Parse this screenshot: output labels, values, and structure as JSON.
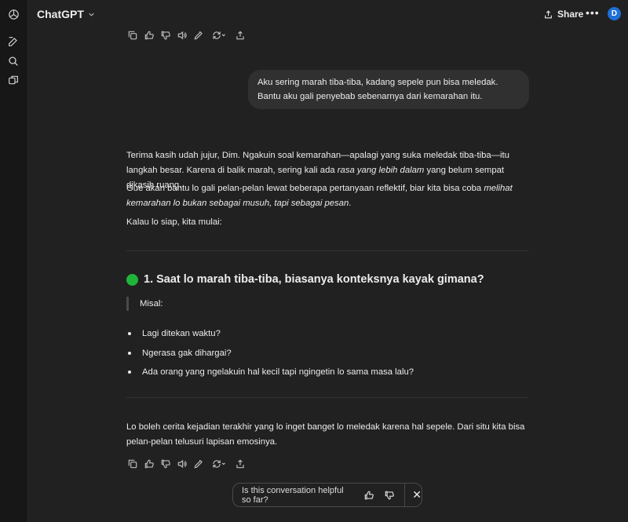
{
  "header": {
    "model_name": "ChatGPT",
    "share_label": "Share",
    "avatar_initial": "D"
  },
  "user_message": "Aku sering marah tiba-tiba, kadang sepele pun bisa meledak. Bantu aku gali penyebab sebenarnya dari kemarahan itu.",
  "assistant": {
    "p1_a": "Terima kasih udah jujur, Dim. Ngakuin soal kemarahan—apalagi yang suka meledak tiba-tiba—itu langkah besar. Karena di balik marah, sering kali ada ",
    "p1_em": "rasa yang lebih dalam",
    "p1_b": " yang belum sempat dikasih ruang.",
    "p2_a": "Gue akan bantu lo gali pelan-pelan lewat beberapa pertanyaan reflektif, biar kita bisa coba ",
    "p2_em": "melihat kemarahan lo bukan sebagai musuh, tapi sebagai pesan",
    "p2_b": ".",
    "p3": "Kalau lo siap, kita mulai:",
    "heading": "1. Saat lo marah tiba-tiba, biasanya konteksnya kayak gimana?",
    "quote": "Misal:",
    "bullets": [
      "Lagi ditekan waktu?",
      "Ngerasa gak dihargai?",
      "Ada orang yang ngelakuin hal kecil tapi ngingetin lo sama masa lalu?"
    ],
    "closing": "Lo boleh cerita kejadian terakhir yang lo inget banget lo meledak karena hal sepele. Dari situ kita bisa pelan-pelan telusuri lapisan emosinya."
  },
  "feedback": {
    "question": "Is this conversation helpful so far?"
  }
}
